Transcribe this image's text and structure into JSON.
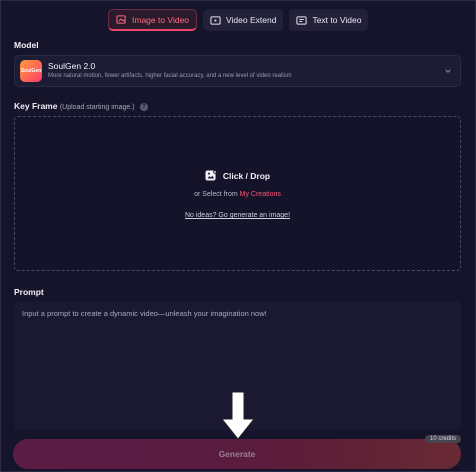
{
  "tabs": [
    {
      "label": "Image to Video",
      "icon": "image-video-icon",
      "active": true
    },
    {
      "label": "Video Extend",
      "icon": "video-extend-icon",
      "active": false
    },
    {
      "label": "Text to Video",
      "icon": "text-video-icon",
      "active": false
    }
  ],
  "model": {
    "section_label": "Model",
    "logo_text": "SoulGen",
    "name": "SoulGen 2.0",
    "description": "More natural motion, fewer artifacts, higher facial accuracy, and a new level of video realism"
  },
  "keyframe": {
    "section_label": "Key Frame",
    "hint": "(Upload starting image.)",
    "click_drop": "Click / Drop",
    "or_select": "or Select from ",
    "my_creations": "My Creations",
    "no_ideas": "No ideas? Go generate an image!"
  },
  "prompt": {
    "section_label": "Prompt",
    "placeholder": "Input a prompt to create a dynamic video—unleash your imagination now!"
  },
  "generate": {
    "label": "Generate",
    "credits": "10 credits"
  },
  "colors": {
    "accent": "#ff5576",
    "background": "#15142a"
  }
}
